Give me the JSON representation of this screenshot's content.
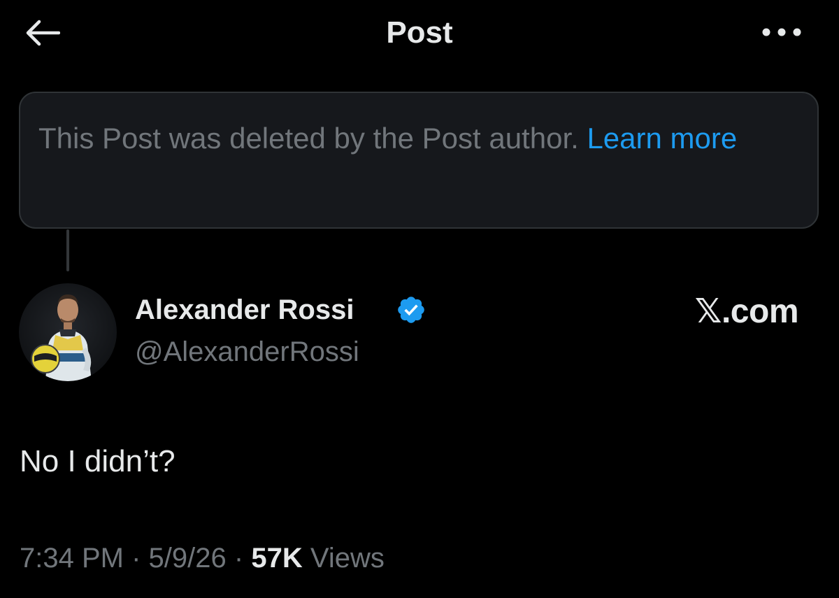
{
  "header": {
    "title": "Post",
    "back_icon": "arrow-left-icon",
    "more_icon": "more-horizontal-icon"
  },
  "deleted_notice": {
    "message": "This Post was deleted by the Post author.",
    "link_label": "Learn more"
  },
  "author": {
    "name": "Alexander Rossi",
    "handle": "@AlexanderRossi",
    "verified": true,
    "badge_icon": "verified-badge-icon"
  },
  "watermark": "𝕏.com",
  "post": {
    "text": "No I didn’t?"
  },
  "meta": {
    "time": "7:34 PM",
    "separator": "·",
    "date": "5/9/26",
    "views_count": "57K",
    "views_label": "Views"
  },
  "colors": {
    "background": "#000000",
    "text_primary": "#e7e9ea",
    "text_secondary": "#71767b",
    "accent": "#1d9bf0",
    "notice_bg": "#16181c",
    "border": "#2f3336"
  }
}
